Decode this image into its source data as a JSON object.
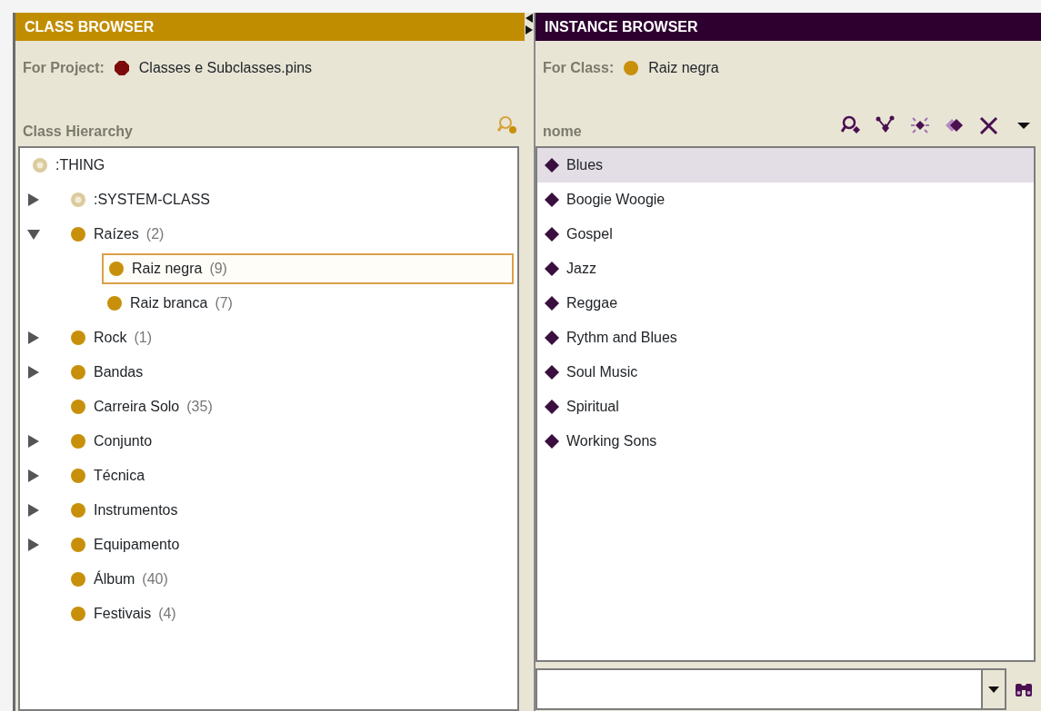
{
  "class_browser": {
    "title": "CLASS BROWSER",
    "project_label": "For Project:",
    "project_name": "Classes e Subclasses.pins",
    "hierarchy_label": "Class Hierarchy",
    "tree": [
      {
        "name": ":THING",
        "kind": "system",
        "selected": false,
        "children": [
          {
            "name": ":SYSTEM-CLASS",
            "kind": "system",
            "selected": false,
            "expanded": false
          },
          {
            "name": "Raízes",
            "count": "(2)",
            "kind": "class",
            "selected": false,
            "expanded": true,
            "children": [
              {
                "name": "Raiz negra",
                "count": "(9)",
                "kind": "class",
                "selected": true
              },
              {
                "name": "Raiz branca",
                "count": "(7)",
                "kind": "class",
                "selected": false
              }
            ]
          },
          {
            "name": "Rock",
            "count": "(1)",
            "kind": "class",
            "selected": false,
            "expanded": false
          },
          {
            "name": "Bandas",
            "kind": "class",
            "selected": false,
            "expanded": false
          },
          {
            "name": "Carreira Solo",
            "count": "(35)",
            "kind": "class",
            "selected": false
          },
          {
            "name": "Conjunto",
            "kind": "class",
            "selected": false,
            "expanded": false
          },
          {
            "name": "Técnica",
            "kind": "class",
            "selected": false,
            "expanded": false
          },
          {
            "name": "Instrumentos",
            "kind": "class",
            "selected": false,
            "expanded": false
          },
          {
            "name": "Equipamento",
            "kind": "class",
            "selected": false,
            "expanded": false
          },
          {
            "name": "Álbum",
            "count": "(40)",
            "kind": "class",
            "selected": false
          },
          {
            "name": "Festivais",
            "count": "(4)",
            "kind": "class",
            "selected": false
          }
        ]
      }
    ]
  },
  "instance_browser": {
    "title": "INSTANCE BROWSER",
    "class_label": "For Class:",
    "class_name": "Raiz negra",
    "column_label": "nome",
    "instances": [
      {
        "name": "Blues",
        "selected": true
      },
      {
        "name": "Boogie Woogie",
        "selected": false
      },
      {
        "name": "Gospel",
        "selected": false
      },
      {
        "name": "Jazz",
        "selected": false
      },
      {
        "name": "Reggae",
        "selected": false
      },
      {
        "name": "Rythm and Blues",
        "selected": false
      },
      {
        "name": "Soul Music",
        "selected": false
      },
      {
        "name": "Spiritual",
        "selected": false
      },
      {
        "name": "Working Sons",
        "selected": false
      }
    ]
  }
}
